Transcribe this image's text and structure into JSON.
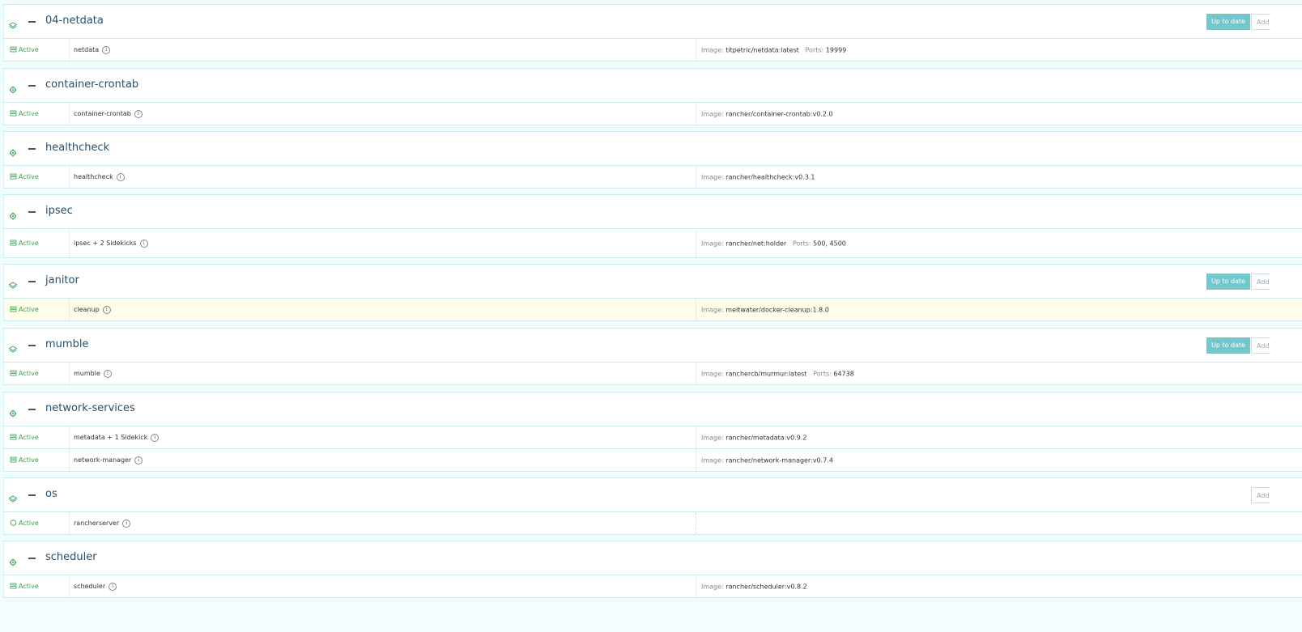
{
  "buttons": {
    "up_to_date": "Up to date",
    "add": "Add"
  },
  "labels": {
    "image": "Image:",
    "ports": "Ports:"
  },
  "stacks": [
    {
      "name": "04-netdata",
      "icon": "layers-icon",
      "buttons": [
        "up_to_date",
        "add"
      ],
      "services": [
        {
          "state": "Active",
          "name": "netdata",
          "image": "titpetric/netdata:latest",
          "ports": "19999"
        }
      ]
    },
    {
      "name": "container-crontab",
      "icon": "gear-icon",
      "services": [
        {
          "state": "Active",
          "name": "container-crontab",
          "image": "rancher/container-crontab:v0.2.0"
        }
      ]
    },
    {
      "name": "healthcheck",
      "icon": "gear-icon",
      "services": [
        {
          "state": "Active",
          "name": "healthcheck",
          "image": "rancher/healthcheck:v0.3.1"
        }
      ]
    },
    {
      "name": "ipsec",
      "icon": "gear-icon",
      "services": [
        {
          "state": "Active",
          "name": "ipsec + 2 Sidekicks",
          "image": "rancher/net:holder",
          "ports": "500,  4500",
          "tall": true
        }
      ]
    },
    {
      "name": "janitor",
      "icon": "layers-icon",
      "buttons": [
        "up_to_date",
        "add"
      ],
      "services": [
        {
          "state": "Active",
          "name": "cleanup",
          "image": "meltwater/docker-cleanup:1.8.0",
          "highlight": true
        }
      ]
    },
    {
      "name": "mumble",
      "icon": "layers-icon",
      "buttons": [
        "up_to_date",
        "add"
      ],
      "services": [
        {
          "state": "Active",
          "name": "mumble",
          "image": "ranchercb/murmur:latest",
          "ports": "64738"
        }
      ]
    },
    {
      "name": "network-services",
      "icon": "gear-icon",
      "services": [
        {
          "state": "Active",
          "name": "metadata + 1 Sidekick",
          "image": "rancher/metadata:v0.9.2"
        },
        {
          "state": "Active",
          "name": "network-manager",
          "image": "rancher/network-manager:v0.7.4"
        }
      ]
    },
    {
      "name": "os",
      "icon": "layers-icon",
      "buttons": [
        "add"
      ],
      "services": [
        {
          "state": "Active",
          "name": "rancherserver",
          "circle": true
        }
      ]
    },
    {
      "name": "scheduler",
      "icon": "gear-icon",
      "services": [
        {
          "state": "Active",
          "name": "scheduler",
          "image": "rancher/scheduler:v0.8.2"
        }
      ]
    }
  ]
}
